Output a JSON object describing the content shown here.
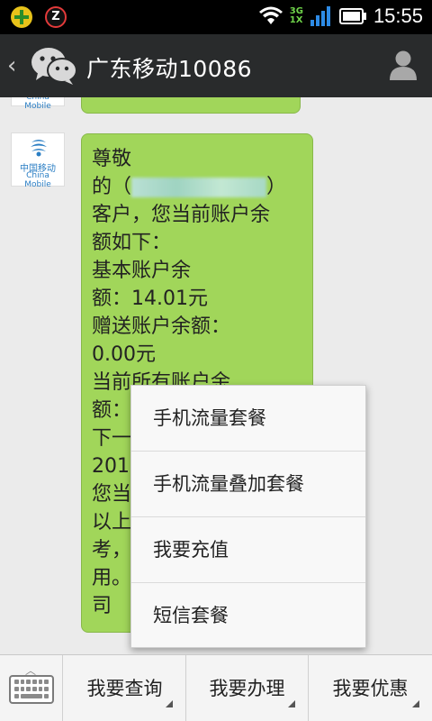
{
  "status_bar": {
    "alarm_glyph": "Z",
    "net_top": "3G",
    "net_bottom": "1X",
    "time": "15:55"
  },
  "header": {
    "title": "广东移动10086"
  },
  "chat": {
    "avatar_label": "中国移动",
    "avatar_sub": "China Mobile",
    "message_before": "尊敬\n的（",
    "message_after": "）\n客户，您当前账户余\n额如下：\n基本账户余\n额：14.01元\n赠送账户余额：\n0.00元\n当前所有账户余\n额：\n下一\n2014\n您当\n以上\n考，\n用。\n司"
  },
  "popup_menu": {
    "items": [
      {
        "label": "手机流量套餐"
      },
      {
        "label": "手机流量叠加套餐"
      },
      {
        "label": "我要充值"
      },
      {
        "label": "短信套餐"
      }
    ]
  },
  "bottom_bar": {
    "tabs": [
      {
        "label": "我要查询"
      },
      {
        "label": "我要办理"
      },
      {
        "label": "我要优惠"
      }
    ]
  },
  "colors": {
    "bubble": "#a1d65a",
    "header": "#292b2c",
    "background": "#ebebeb"
  }
}
